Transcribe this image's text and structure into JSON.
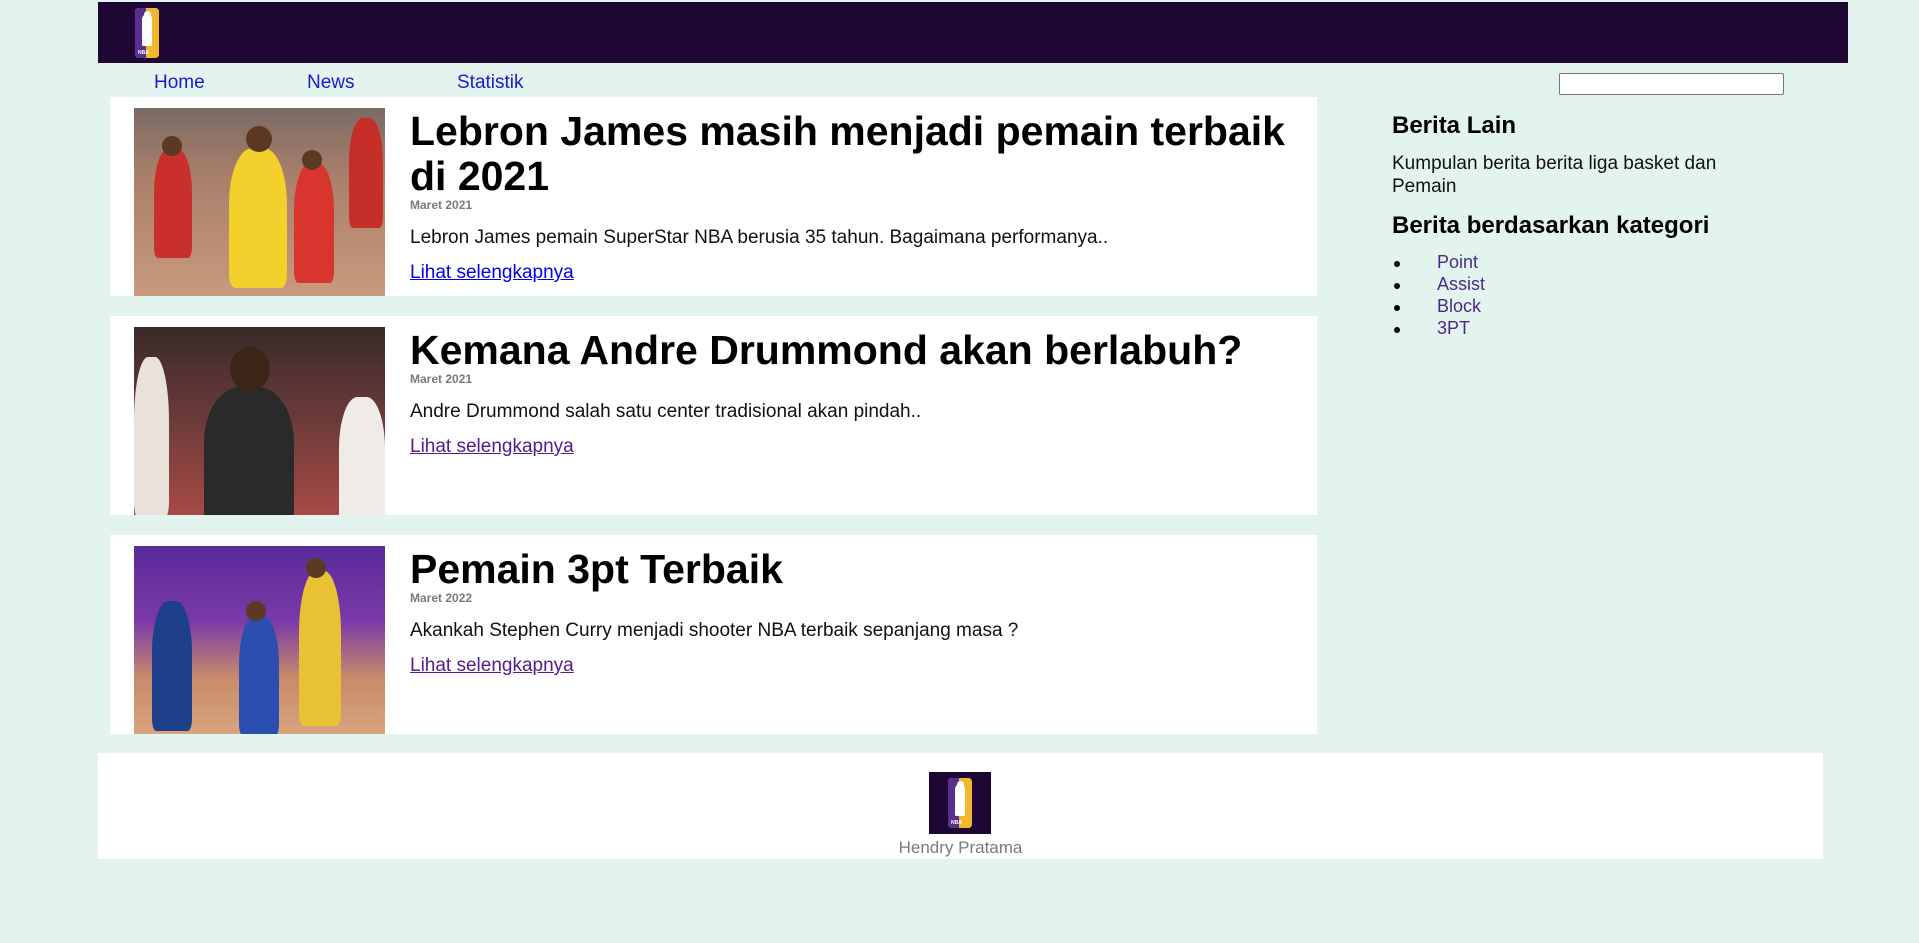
{
  "brand": {
    "logo_icon": "nba-logo-icon",
    "logo_text": "NBA"
  },
  "nav": {
    "items": [
      "Home",
      "News",
      "Statistik"
    ]
  },
  "search": {
    "placeholder": "",
    "value": ""
  },
  "articles": [
    {
      "title": "Lebron James masih menjadi pemain terbaik di 2021",
      "date": "Maret 2021",
      "summary": "Lebron James pemain SuperStar NBA berusia 35 tahun. Bagaimana performanya..",
      "link": "Lihat selengkapnya"
    },
    {
      "title": "Kemana Andre Drummond akan berlabuh?",
      "date": "Maret 2021",
      "summary": "Andre Drummond salah satu center tradisional akan pindah..",
      "link": "Lihat selengkapnya"
    },
    {
      "title": "Pemain 3pt Terbaik",
      "date": "Maret 2022",
      "summary": "Akankah Stephen Curry menjadi shooter NBA terbaik sepanjang masa ?",
      "link": "Lihat selengkapnya"
    }
  ],
  "sidebar": {
    "heading": "Berita Lain",
    "intro": "Kumpulan berita berita liga basket dan Pemain",
    "categories_heading": "Berita berdasarkan kategori",
    "categories": [
      "Point",
      "Assist",
      "Block",
      "3PT"
    ]
  },
  "footer": {
    "author": "Hendry Pratama"
  },
  "colors": {
    "page_bg": "#e3f4ee",
    "header_bg": "#1f0733",
    "nav_link": "#1a1acc",
    "link_unvisited": "#0000ee",
    "link_visited": "#551a8b",
    "category_link": "#4a2b88"
  }
}
